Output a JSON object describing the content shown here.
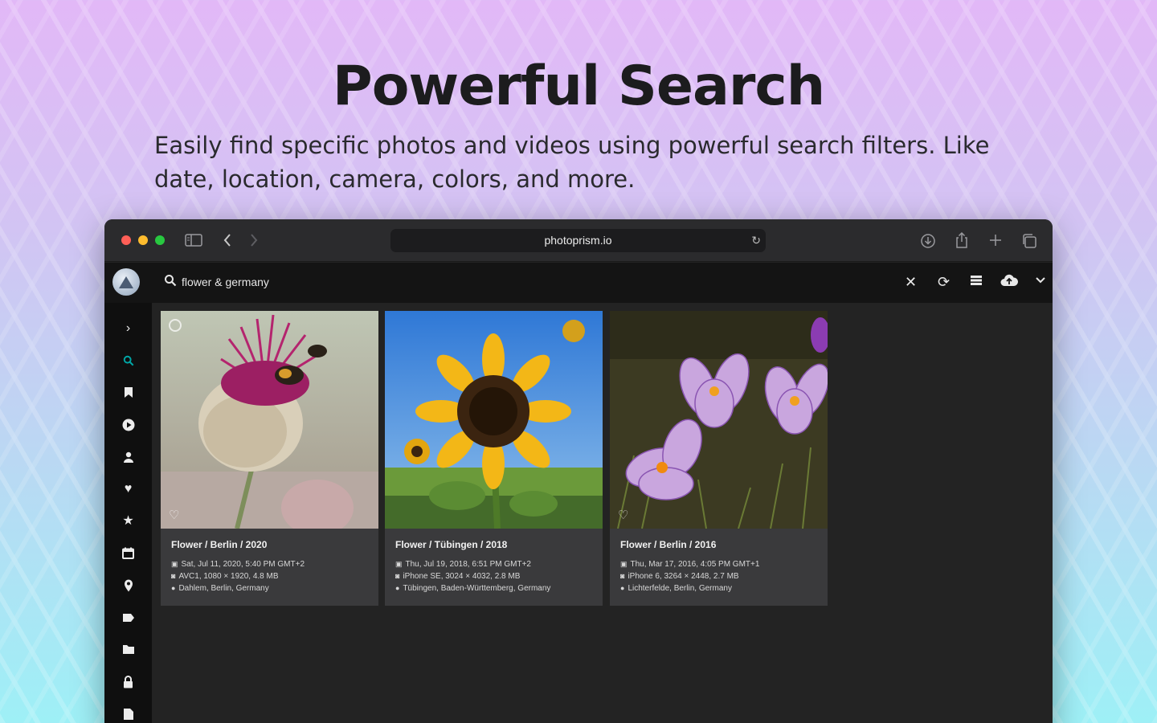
{
  "hero": {
    "title": "Powerful Search",
    "subtitle": "Easily find specific photos and videos using powerful search filters. Like date, location, camera, colors, and more."
  },
  "browser": {
    "url": "photoprism.io",
    "icons": [
      "sidebar-icon",
      "back-icon",
      "forward-icon",
      "reload-icon",
      "download-icon",
      "share-icon",
      "new-tab-icon",
      "tabs-icon"
    ]
  },
  "app": {
    "search": {
      "value": "flower & germany",
      "placeholder": "Search"
    },
    "actions": [
      "clear-icon",
      "refresh-icon",
      "list-view-icon",
      "upload-icon",
      "expand-icon"
    ],
    "nav": [
      "expand",
      "search",
      "albums",
      "videos",
      "people",
      "favorites",
      "moments",
      "calendar",
      "places",
      "labels",
      "folders",
      "private",
      "library"
    ],
    "accent": "#00a6a6"
  },
  "photos": [
    {
      "title": "Flower / Berlin / 2020",
      "date": "Sat, Jul 11, 2020, 5:40 PM GMT+2",
      "camera": "AVC1, 1080 × 1920, 4.8 MB",
      "location": "Dahlem, Berlin, Germany"
    },
    {
      "title": "Flower / Tübingen / 2018",
      "date": "Thu, Jul 19, 2018, 6:51 PM GMT+2",
      "camera": "iPhone SE, 3024 × 4032, 2.8 MB",
      "location": "Tübingen, Baden-Württemberg, Germany"
    },
    {
      "title": "Flower / Berlin / 2016",
      "date": "Thu, Mar 17, 2016, 4:05 PM GMT+1",
      "camera": "iPhone 6, 3264 × 2448, 2.7 MB",
      "location": "Lichterfelde, Berlin, Germany"
    }
  ]
}
